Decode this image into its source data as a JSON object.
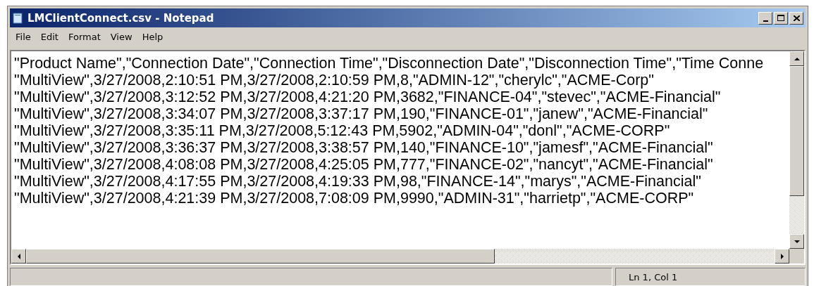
{
  "window": {
    "title": "LMClientConnect.csv - Notepad"
  },
  "menu": [
    "File",
    "Edit",
    "Format",
    "View",
    "Help"
  ],
  "lines": [
    "\"Product Name\",\"Connection Date\",\"Connection Time\",\"Disconnection Date\",\"Disconnection Time\",\"Time Conne",
    "\"MultiView\",3/27/2008,2:10:51 PM,3/27/2008,2:10:59 PM,8,\"ADMIN-12\",\"cherylc\",\"ACME-Corp\"",
    "\"MultiView\",3/27/2008,3:12:52 PM,3/27/2008,4:21:20 PM,3682,\"FINANCE-04\",\"stevec\",\"ACME-Financial\"",
    "\"MultiView\",3/27/2008,3:34:07 PM,3/27/2008,3:37:17 PM,190,\"FINANCE-01\",\"janew\",\"ACME-Financial\"",
    "\"MultiView\",3/27/2008,3:35:11 PM,3/27/2008,5:12:43 PM,5902,\"ADMIN-04\",\"donl\",\"ACME-CORP\"",
    "\"MultiView\",3/27/2008,3:36:37 PM,3/27/2008,3:38:57 PM,140,\"FINANCE-10\",\"jamesf\",\"ACME-Financial\"",
    "\"MultiView\",3/27/2008,4:08:08 PM,3/27/2008,4:25:05 PM,777,\"FINANCE-02\",\"nancyt\",\"ACME-Financial\"",
    "\"MultiView\",3/27/2008,4:17:55 PM,3/27/2008,4:19:33 PM,98,\"FINANCE-14\",\"marys\",\"ACME-Financial\"",
    "\"MultiView\",3/27/2008,4:21:39 PM,3/27/2008,7:08:09 PM,9990,\"ADMIN-31\",\"harrietp\",\"ACME-CORP\""
  ],
  "status_bar": {
    "position": "Ln 1, Col 1"
  }
}
